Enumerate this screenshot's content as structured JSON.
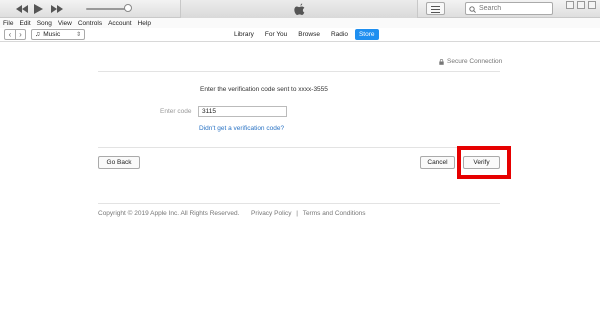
{
  "menu": [
    "File",
    "Edit",
    "Song",
    "View",
    "Controls",
    "Account",
    "Help"
  ],
  "search": {
    "placeholder": "Search"
  },
  "library_selector": {
    "value": "Music"
  },
  "tabs": [
    {
      "label": "Library",
      "active": false
    },
    {
      "label": "For You",
      "active": false
    },
    {
      "label": "Browse",
      "active": false
    },
    {
      "label": "Radio",
      "active": false
    },
    {
      "label": "Store",
      "active": true
    }
  ],
  "secure_connection": "Secure Connection",
  "verification": {
    "instruction": "Enter the verification code sent to xxxx-3555",
    "code_label": "Enter code",
    "code_value": "3115",
    "resend_link": "Didn't get a verification code?"
  },
  "buttons": {
    "go_back": "Go Back",
    "cancel": "Cancel",
    "verify": "Verify"
  },
  "footer": {
    "copyright": "Copyright © 2019 Apple Inc. All Rights Reserved.",
    "privacy": "Privacy Policy",
    "separator": "|",
    "terms": "Terms and Conditions"
  },
  "colors": {
    "accent": "#1f8ff0",
    "link": "#2a73c4",
    "highlight": "#e60000"
  },
  "icons": [
    "previous-icon",
    "play-icon",
    "next-icon",
    "apple-logo-icon",
    "list-icon",
    "search-icon",
    "lock-icon",
    "music-note-icon"
  ]
}
